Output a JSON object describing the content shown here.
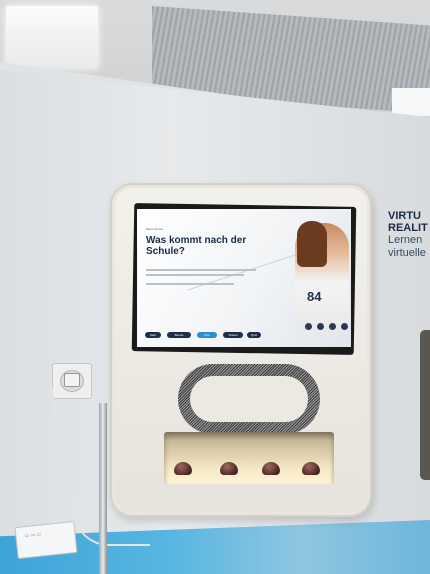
{
  "screen": {
    "small_text": "Basis Schule",
    "title": "Was kommt nach der Schule?",
    "jersey_number": "84",
    "nav_buttons": [
      "Start",
      "Berufe",
      "Info",
      "Videos",
      "Quiz"
    ]
  },
  "wall_text": {
    "line1": "VIRTU",
    "line2": "REALIT",
    "line3": "Lernen",
    "line4": "virtuelle"
  }
}
